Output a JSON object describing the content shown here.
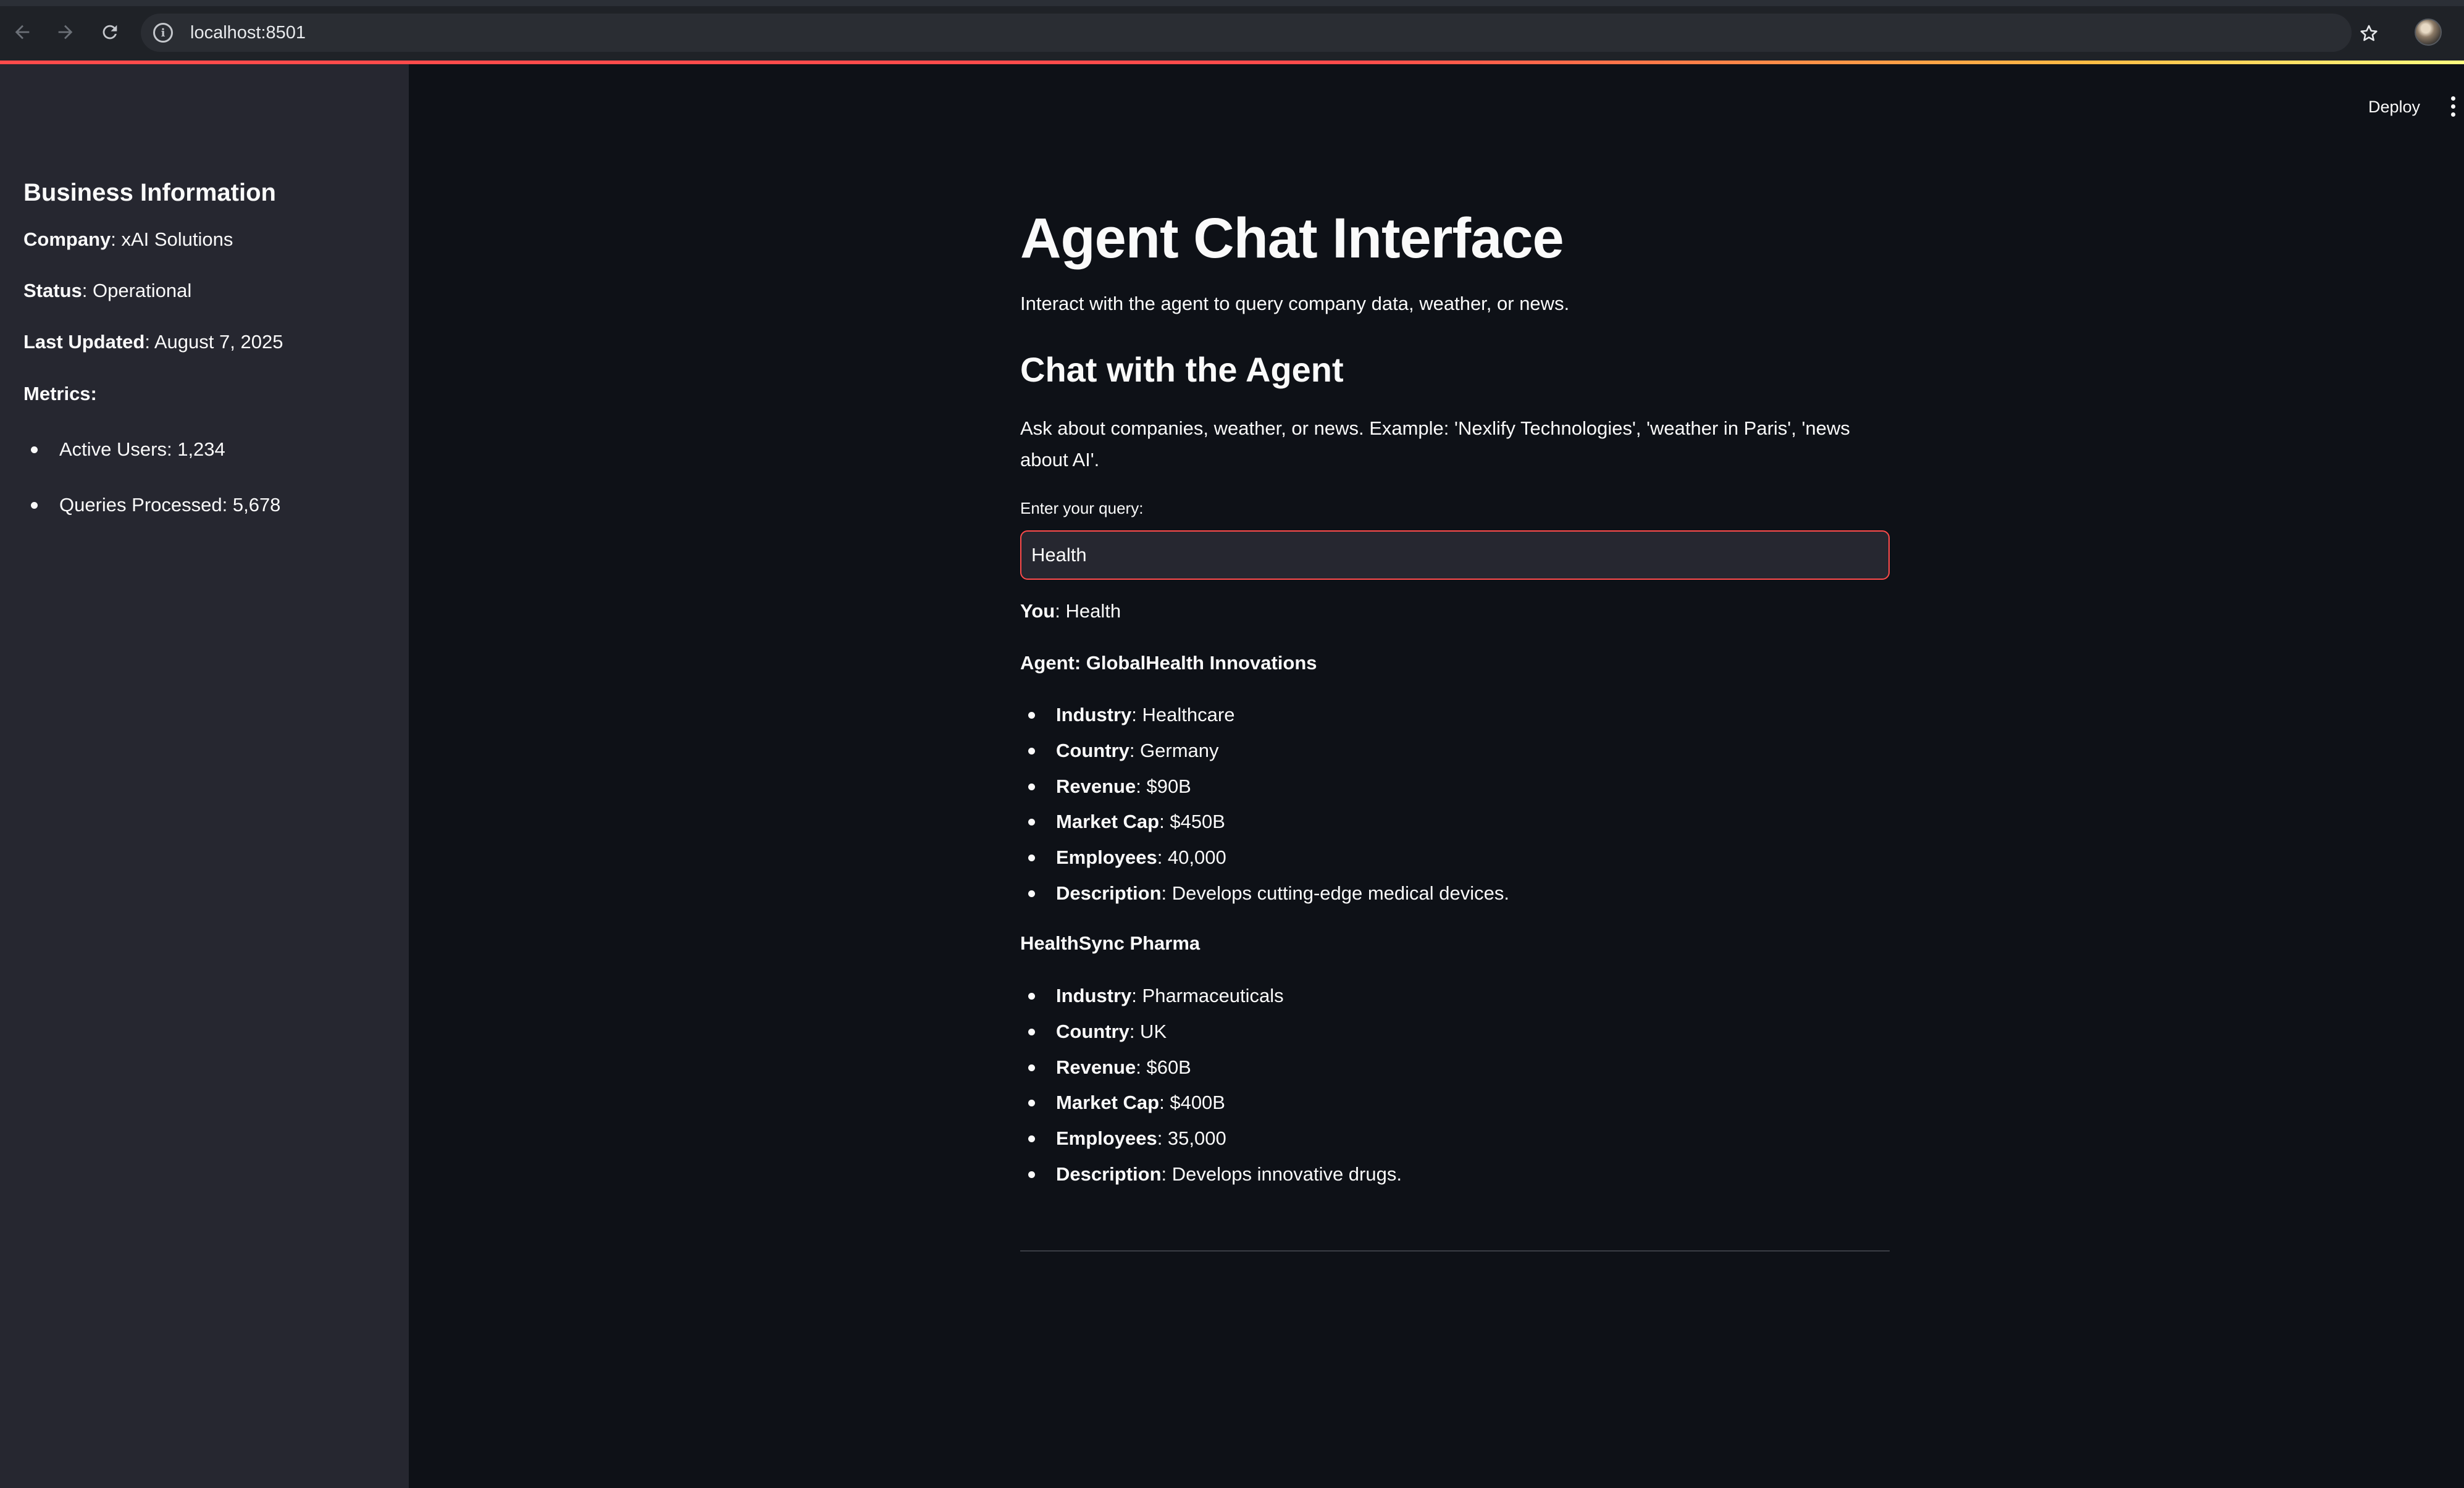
{
  "browser": {
    "url": "localhost:8501"
  },
  "header": {
    "deploy_label": "Deploy"
  },
  "sidebar": {
    "title": "Business Information",
    "company_label": "Company",
    "company_value": ": xAI Solutions",
    "status_label": "Status",
    "status_value": ": Operational",
    "updated_label": "Last Updated",
    "updated_value": ": August 7, 2025",
    "metrics_label": "Metrics:",
    "metrics": [
      "Active Users: 1,234",
      "Queries Processed: 5,678"
    ]
  },
  "main": {
    "title": "Agent Chat Interface",
    "intro": "Interact with the agent to query company data, weather, or news.",
    "section_title": "Chat with the Agent",
    "help": "Ask about companies, weather, or news. Example: 'Nexlify Technologies', 'weather in Paris', 'news about AI'.",
    "input_label": "Enter your query:",
    "input_value": "Health",
    "you_label": "You",
    "you_value": ": Health",
    "agent_line": "Agent: GlobalHealth Innovations",
    "company1": [
      {
        "label": "Industry",
        "value": ": Healthcare"
      },
      {
        "label": "Country",
        "value": ": Germany"
      },
      {
        "label": "Revenue",
        "value": ": $90B"
      },
      {
        "label": "Market Cap",
        "value": ": $450B"
      },
      {
        "label": "Employees",
        "value": ": 40,000"
      },
      {
        "label": "Description",
        "value": ": Develops cutting-edge medical devices."
      }
    ],
    "company2_name": "HealthSync Pharma",
    "company2": [
      {
        "label": "Industry",
        "value": ": Pharmaceuticals"
      },
      {
        "label": "Country",
        "value": ": UK"
      },
      {
        "label": "Revenue",
        "value": ": $60B"
      },
      {
        "label": "Market Cap",
        "value": ": $400B"
      },
      {
        "label": "Employees",
        "value": ": 35,000"
      },
      {
        "label": "Description",
        "value": ": Develops innovative drugs."
      }
    ]
  },
  "colors": {
    "background": "#0e1117",
    "sidebar": "#262730",
    "accent": "#ff4b4b",
    "text": "#fafafa"
  }
}
